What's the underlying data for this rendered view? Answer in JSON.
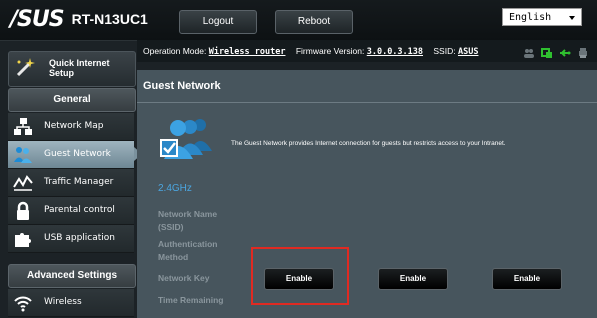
{
  "header": {
    "brand": "/SUS",
    "model": "RT-N13UC1",
    "logout_label": "Logout",
    "reboot_label": "Reboot",
    "language": "English"
  },
  "sidebar": {
    "quick_setup": "Quick Internet Setup",
    "general_heading": "General",
    "general_items": [
      {
        "label": "Network Map",
        "icon": "network-map-icon"
      },
      {
        "label": "Guest Network",
        "icon": "guest-network-icon",
        "active": true
      },
      {
        "label": "Traffic Manager",
        "icon": "traffic-manager-icon"
      },
      {
        "label": "Parental control",
        "icon": "parental-control-icon"
      },
      {
        "label": "USB application",
        "icon": "usb-application-icon"
      }
    ],
    "advanced_heading": "Advanced Settings",
    "advanced_items": [
      {
        "label": "Wireless",
        "icon": "wireless-icon"
      }
    ]
  },
  "status": {
    "operation_mode_label": "Operation Mode:",
    "operation_mode_value": "Wireless router",
    "firmware_label": "Firmware Version:",
    "firmware_value": "3.0.0.3.138",
    "ssid_label": "SSID:",
    "ssid_value": "ASUS"
  },
  "panel": {
    "title": "Guest Network",
    "description": "The Guest Network provides Internet connection for guests but restricts access to your Intranet.",
    "band": "2.4GHz",
    "fields": {
      "network_name": "Network Name (SSID)",
      "auth_method": "Authentication Method",
      "network_key": "Network Key",
      "time_remaining": "Time Remaining"
    },
    "enable_buttons": [
      "Enable",
      "Enable",
      "Enable"
    ]
  },
  "colors": {
    "accent_band": "#4ba6e0",
    "highlight": "#e02a22",
    "panel_bg": "#47555d"
  }
}
